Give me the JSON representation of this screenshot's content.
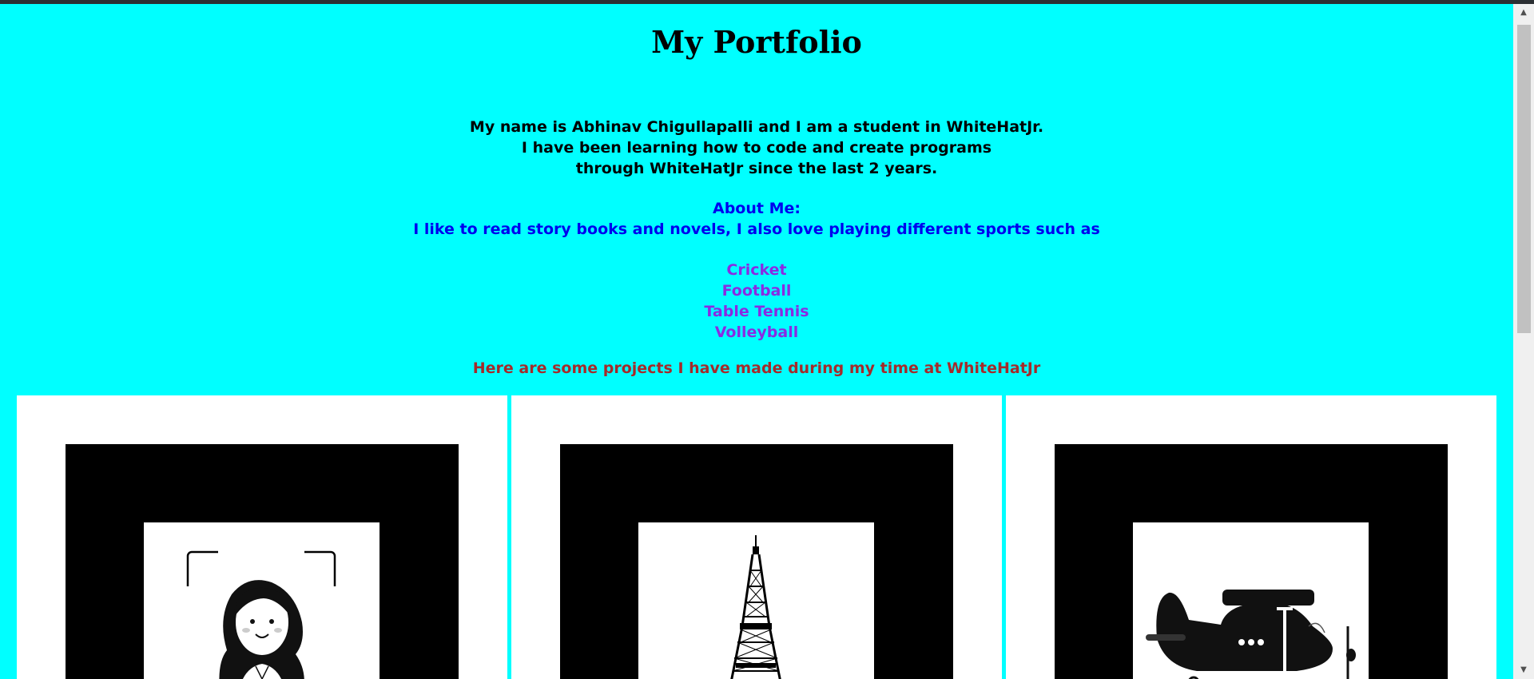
{
  "page": {
    "title": "My Portfolio",
    "intro_lines": [
      "My name is Abhinav Chigullapalli and I am a student in WhiteHatJr.",
      "I have been learning how to code and create programs",
      "through WhiteHatJr since the last 2 years."
    ],
    "about_heading": "About Me:",
    "about_text": "I like to read story books and novels, I also love playing different sports such as",
    "sports": [
      "Cricket",
      "Football",
      "Table Tennis",
      "Volleyball"
    ],
    "projects_heading": "Here are some projects I have made during my time at WhiteHatJr"
  },
  "projects": [
    {
      "icon": "girl-portrait-icon"
    },
    {
      "icon": "eiffel-tower-icon"
    },
    {
      "icon": "airplane-icon"
    }
  ],
  "colors": {
    "background": "#00ffff",
    "intro": "#000000",
    "about": "#0000ee",
    "sports": "#8a2be2",
    "projects_heading": "#a52a2a"
  },
  "scrollbar": {
    "up_icon": "scroll-up-arrow-icon",
    "down_icon": "scroll-down-arrow-icon"
  }
}
